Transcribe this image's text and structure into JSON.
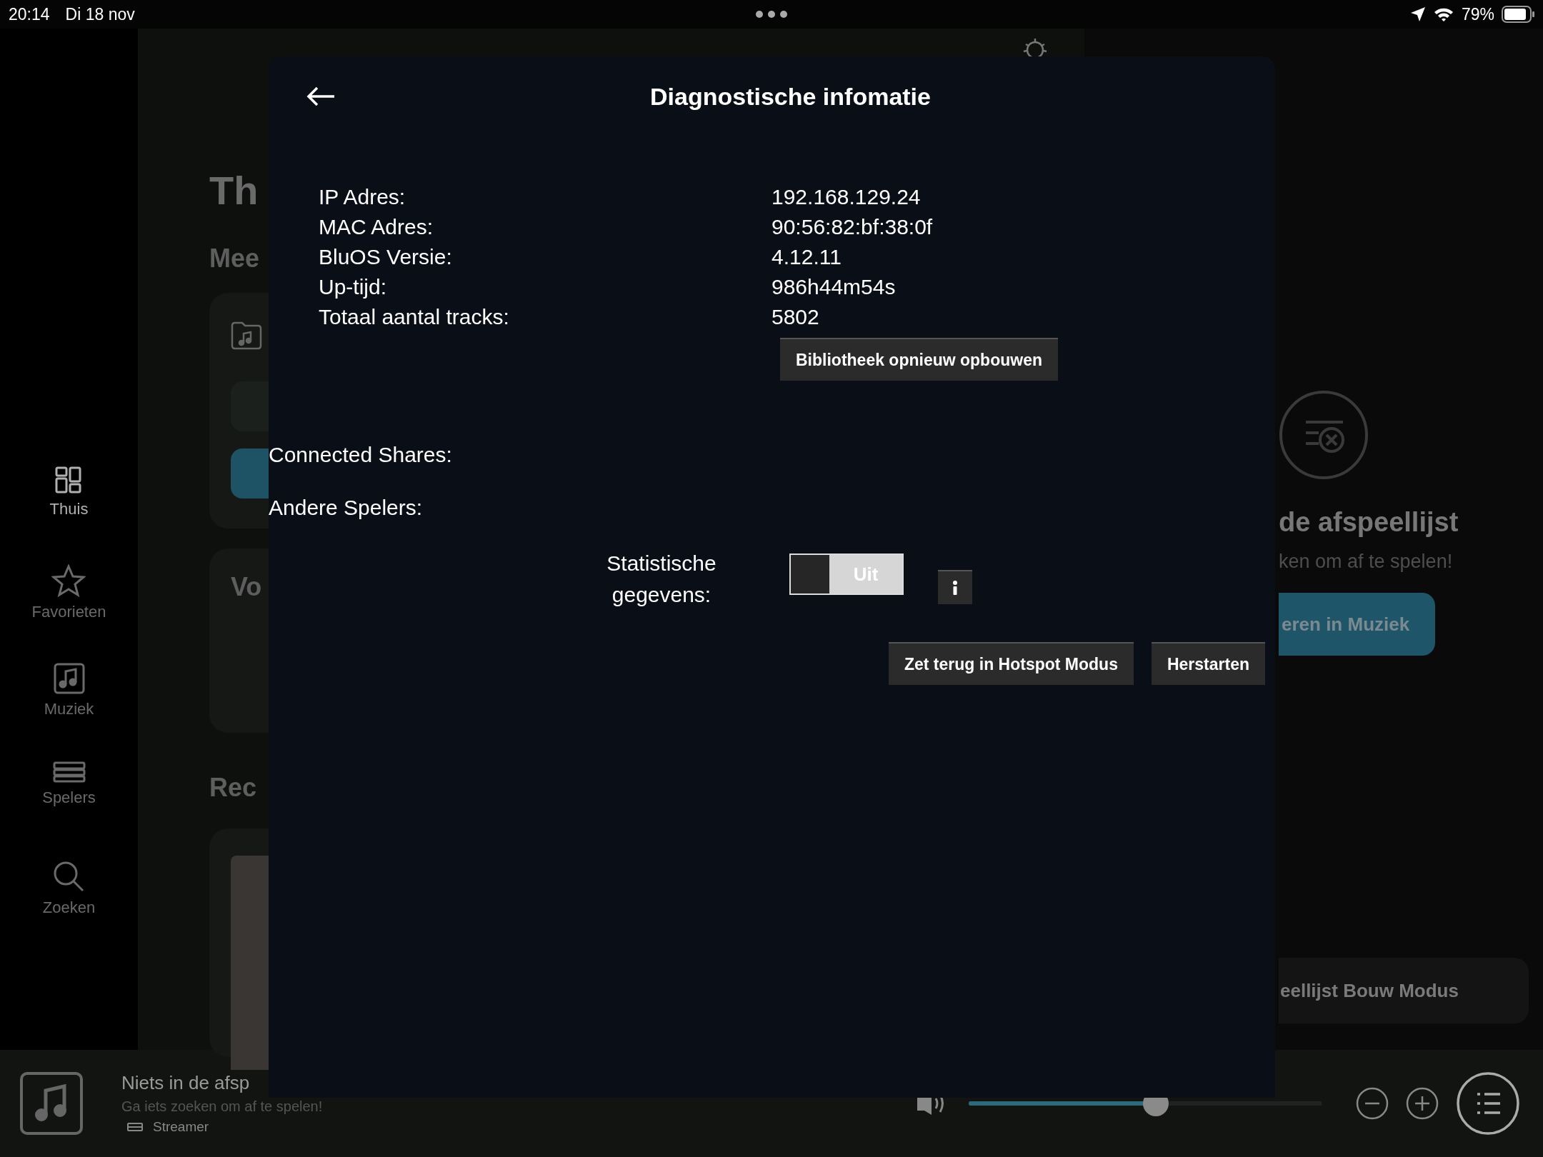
{
  "status_bar": {
    "time": "20:14",
    "date": "Di 18 nov",
    "battery": "79%"
  },
  "sidebar": {
    "items": [
      {
        "label": "Thuis",
        "kind": "home",
        "selected": true
      },
      {
        "label": "Favorieten",
        "kind": "star",
        "selected": false
      },
      {
        "label": "Muziek",
        "kind": "music",
        "selected": false
      },
      {
        "label": "Spelers",
        "kind": "players",
        "selected": false
      },
      {
        "label": "Zoeken",
        "kind": "search",
        "selected": false
      }
    ]
  },
  "background": {
    "heading": "Th",
    "sections": [
      "Mee",
      "Vo",
      "Rec"
    ],
    "queue": {
      "title": "de afspeellijst",
      "subtitle": "ken om af te spelen!",
      "button": "eren in Muziek",
      "mode_button": "eellijst Bouw Modus"
    }
  },
  "player": {
    "title": "Niets in de afsp",
    "subtitle": "Ga iets zoeken om af te spelen!",
    "device": "Streamer",
    "volume": {
      "level": 0.53
    }
  },
  "dialog": {
    "title": "Diagnostische infomatie",
    "info": [
      {
        "label": "IP Adres:",
        "value": "192.168.129.24"
      },
      {
        "label": "MAC Adres:",
        "value": "90:56:82:bf:38:0f"
      },
      {
        "label": "BluOS Versie:",
        "value": "4.12.11"
      },
      {
        "label": "Up-tijd:",
        "value": "986h44m54s"
      },
      {
        "label": "Totaal aantal tracks:",
        "value": "5802"
      }
    ],
    "rebuild_button": "Bibliotheek opnieuw opbouwen",
    "sections": [
      "Connected Shares:",
      "Andere Spelers:"
    ],
    "statistics": {
      "label": "Statistische gegevens:",
      "toggle": {
        "on": false,
        "label": "Uit"
      }
    },
    "buttons": [
      "Zet terug in Hotspot Modus",
      "Herstarten"
    ]
  }
}
